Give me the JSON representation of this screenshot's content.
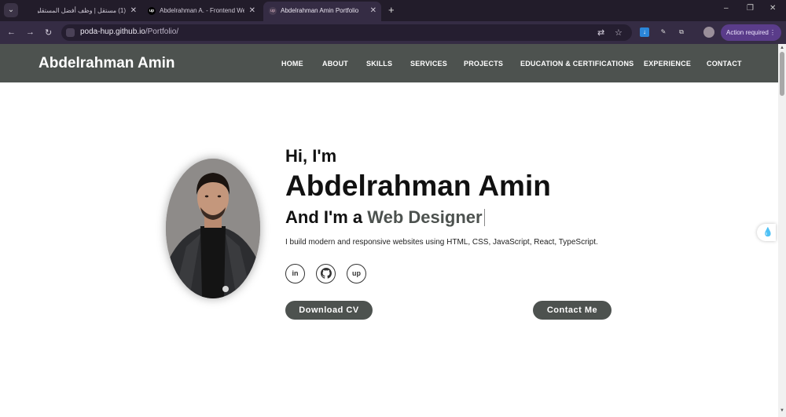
{
  "browser": {
    "tabs": [
      {
        "title": "(1) مستقل | وظف أفضل المستقلين",
        "favicon": "mostaql-icon"
      },
      {
        "title": "Abdelrahman A. - Frontend Web",
        "favicon": "upwork-icon",
        "favicon_text": "up"
      },
      {
        "title": "Abdelrahman Amin Portfolio",
        "favicon": "page-icon",
        "favicon_text": "up",
        "active": true
      }
    ],
    "new_tab": "+",
    "url_host": "poda-hup.github.io",
    "url_path": "/Portfolio/",
    "action_required": "Action required",
    "window_controls": [
      "–",
      "❐",
      "✕"
    ]
  },
  "site": {
    "logo": "Abdelrahman Amin",
    "nav": [
      "HOME",
      "ABOUT",
      "SKILLS",
      "SERVICES",
      "PROJECTS",
      "EDUCATION & CERTIFICATIONS",
      "EXPERIENCE",
      "CONTACT"
    ]
  },
  "hero": {
    "greeting": "Hi, I'm",
    "name": "Abdelrahman Amin",
    "role_prefix": "And I'm a ",
    "role_typed": "Web Designer",
    "description": "I build modern and responsive websites using HTML, CSS, JavaScript, React, TypeScript.",
    "social": [
      {
        "icon": "linkedin-icon",
        "glyph": "in"
      },
      {
        "icon": "github-icon",
        "glyph": ""
      },
      {
        "icon": "upwork-icon",
        "glyph": "up"
      }
    ],
    "download_cv": "Download CV",
    "contact_me": "Contact Me"
  },
  "colors": {
    "header_bg": "#4d524f",
    "button_bg": "#4d524f",
    "browser_frame": "#221c2a",
    "accent_purple": "#5a3c8a"
  }
}
